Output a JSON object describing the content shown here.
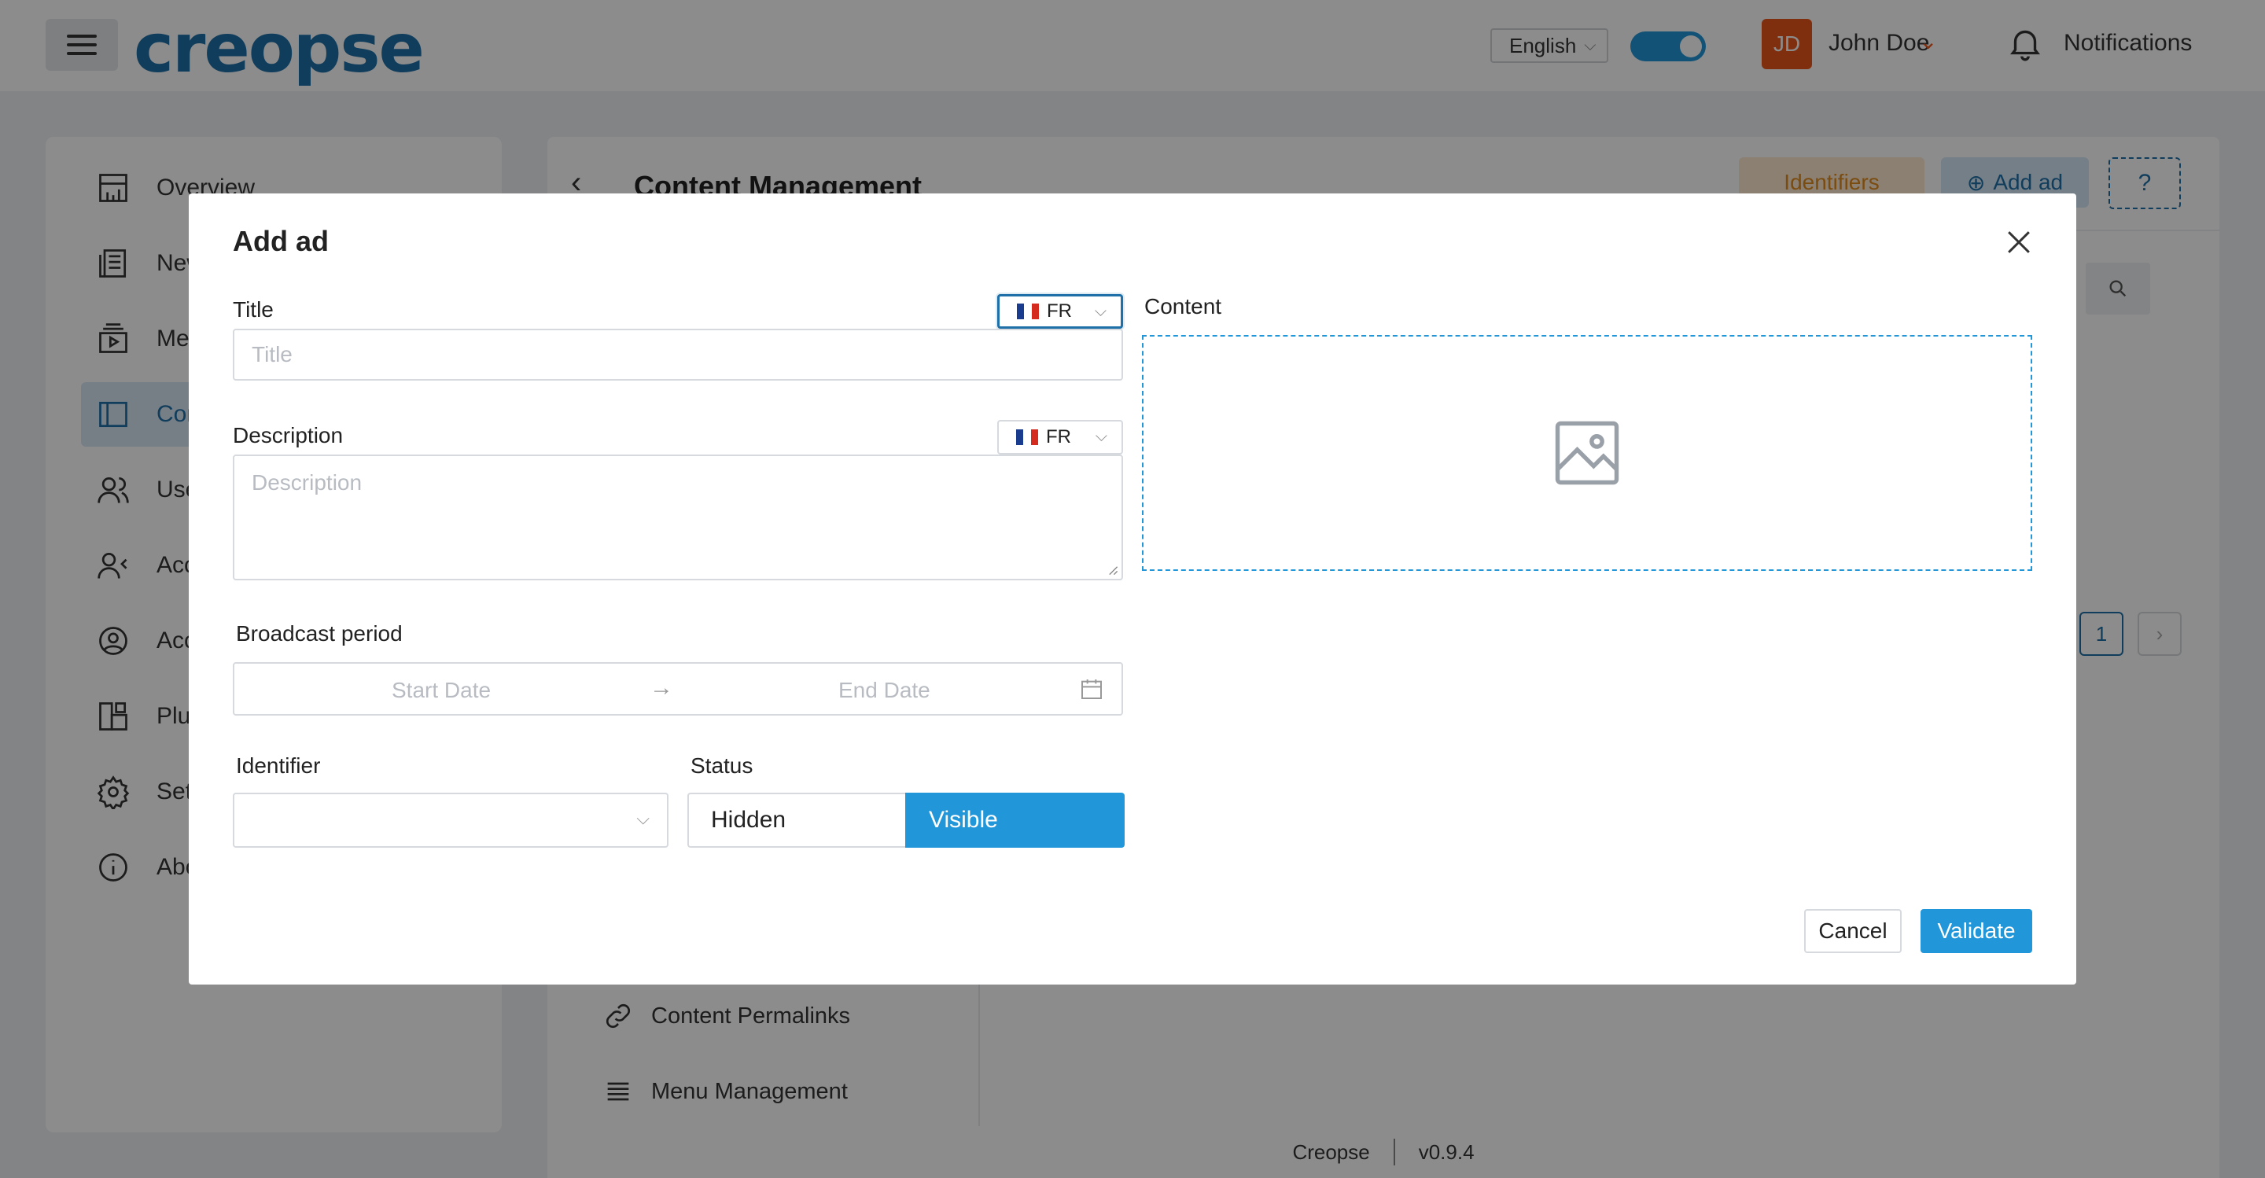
{
  "app": {
    "logo_text": "creopse",
    "language": "English",
    "user_initials": "JD",
    "user_name": "John Doe",
    "notifications_label": "Notifications"
  },
  "sidebar": {
    "items": [
      {
        "label": "Overview",
        "icon": "dashboard-icon"
      },
      {
        "label": "News",
        "icon": "newspaper-icon"
      },
      {
        "label": "Media",
        "icon": "media-icon"
      },
      {
        "label": "Content",
        "icon": "layout-icon",
        "active": true
      },
      {
        "label": "Users",
        "icon": "users-icon"
      },
      {
        "label": "Access",
        "icon": "user-access-icon"
      },
      {
        "label": "Account",
        "icon": "user-circle-icon"
      },
      {
        "label": "Plugins",
        "icon": "plugins-icon"
      },
      {
        "label": "Settings",
        "icon": "gear-icon"
      },
      {
        "label": "About",
        "icon": "info-icon"
      }
    ]
  },
  "main": {
    "title": "Content Management",
    "identifiers_label": "Identifiers",
    "add_ad_label": "Add ad",
    "current_page": "1",
    "sub_items": [
      "Content Permalinks",
      "Menu Management"
    ]
  },
  "footer": {
    "app_name": "Creopse",
    "version": "v0.9.4"
  },
  "modal": {
    "title": "Add ad",
    "title_label": "Title",
    "title_placeholder": "Title",
    "title_lang": "FR",
    "description_label": "Description",
    "description_placeholder": "Description",
    "description_lang": "FR",
    "content_label": "Content",
    "broadcast_label": "Broadcast period",
    "start_date_placeholder": "Start Date",
    "end_date_placeholder": "End Date",
    "identifier_label": "Identifier",
    "status_label": "Status",
    "status_options": [
      "Hidden",
      "Visible"
    ],
    "status_selected": "Visible",
    "cancel_label": "Cancel",
    "validate_label": "Validate"
  },
  "colors": {
    "accent": "#2196d9",
    "brand": "#1f6fa8",
    "avatar": "#e8561a",
    "identifiers": "#e08a1e"
  }
}
